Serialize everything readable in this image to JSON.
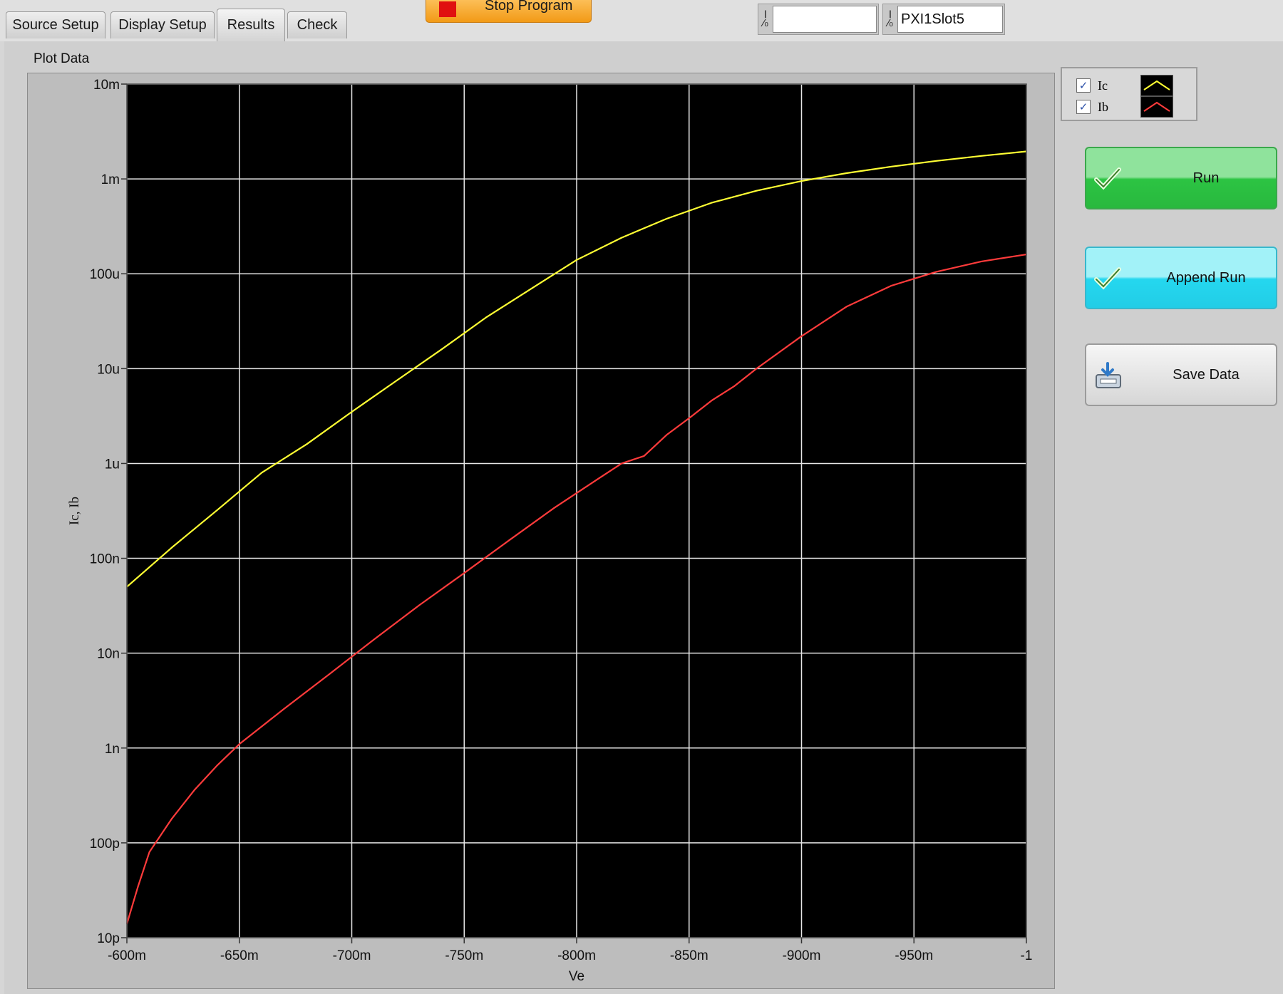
{
  "tabs": [
    {
      "label": "Source Setup"
    },
    {
      "label": "Display Setup"
    },
    {
      "label": "Results"
    },
    {
      "label": "Check"
    }
  ],
  "stop_button": {
    "label": "Stop Program"
  },
  "io_fields": [
    {
      "value": ""
    },
    {
      "value": "PXI1Slot5"
    }
  ],
  "plot": {
    "title": "Plot Data"
  },
  "legend": [
    {
      "name": "Ic",
      "color": "#ffff33",
      "checked": true
    },
    {
      "name": "Ib",
      "color": "#ff3b3b",
      "checked": true
    }
  ],
  "buttons": {
    "run": "Run",
    "append_run": "Append Run",
    "save_data": "Save Data"
  },
  "chart_data": {
    "type": "line",
    "title": "",
    "xlabel": "Ve",
    "ylabel": "Ic, Ib",
    "x_range": [
      -0.6,
      -1.0
    ],
    "y_scale": "log",
    "y_range": [
      1e-11,
      0.01
    ],
    "x_ticks": [
      "-600m",
      "-650m",
      "-700m",
      "-750m",
      "-800m",
      "-850m",
      "-900m",
      "-950m",
      "-1"
    ],
    "y_ticks": [
      "10p",
      "100p",
      "1n",
      "10n",
      "100n",
      "1u",
      "10u",
      "100u",
      "1m",
      "10m"
    ],
    "grid": true,
    "background": "#000000",
    "series": [
      {
        "name": "Ic",
        "color": "#ffff33",
        "x": [
          -0.6,
          -0.62,
          -0.64,
          -0.66,
          -0.68,
          -0.7,
          -0.72,
          -0.74,
          -0.76,
          -0.78,
          -0.8,
          -0.82,
          -0.84,
          -0.86,
          -0.88,
          -0.9,
          -0.92,
          -0.94,
          -0.96,
          -0.98,
          -1.0
        ],
        "y": [
          5e-08,
          1.3e-07,
          3.2e-07,
          8e-07,
          1.6e-06,
          3.5e-06,
          7.5e-06,
          1.6e-05,
          3.5e-05,
          7e-05,
          0.00014,
          0.00024,
          0.00038,
          0.00056,
          0.00075,
          0.00095,
          0.00115,
          0.00135,
          0.00155,
          0.00175,
          0.00195
        ]
      },
      {
        "name": "Ib",
        "color": "#ff3b3b",
        "x": [
          -0.6,
          -0.605,
          -0.61,
          -0.62,
          -0.63,
          -0.64,
          -0.65,
          -0.67,
          -0.69,
          -0.71,
          -0.73,
          -0.75,
          -0.77,
          -0.79,
          -0.81,
          -0.82,
          -0.83,
          -0.84,
          -0.85,
          -0.86,
          -0.87,
          -0.88,
          -0.9,
          -0.92,
          -0.94,
          -0.96,
          -0.98,
          -1.0
        ],
        "y": [
          1.4e-11,
          3.5e-11,
          8e-11,
          1.8e-10,
          3.6e-10,
          6.5e-10,
          1.1e-09,
          2.6e-09,
          6e-09,
          1.4e-08,
          3.2e-08,
          7e-08,
          1.55e-07,
          3.4e-07,
          7e-07,
          1e-06,
          1.2e-06,
          2e-06,
          3e-06,
          4.6e-06,
          6.5e-06,
          1e-05,
          2.2e-05,
          4.5e-05,
          7.5e-05,
          0.000105,
          0.000135,
          0.00016
        ]
      }
    ]
  }
}
